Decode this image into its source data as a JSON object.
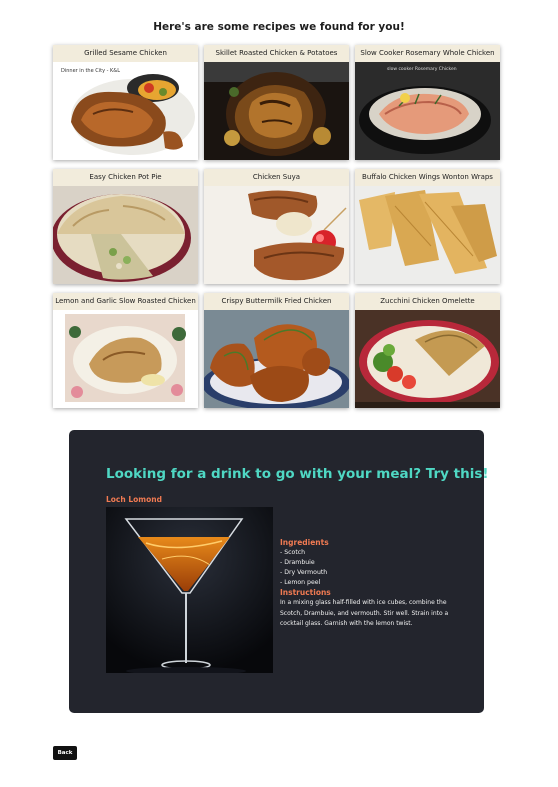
{
  "page": {
    "heading": "Here's are some recipes we found for you!"
  },
  "recipes": [
    {
      "title": "Grilled Sesame Chicken",
      "image": "grilled-chicken-plate-image"
    },
    {
      "title": "Skillet Roasted Chicken & Potatoes",
      "image": "roasted-whole-chicken-image"
    },
    {
      "title": "Slow Cooker Rosemary Whole Chicken",
      "image": "slow-cooker-chicken-image"
    },
    {
      "title": "Easy Chicken Pot Pie",
      "image": "pot-pie-image"
    },
    {
      "title": "Chicken Suya",
      "image": "chicken-suya-image"
    },
    {
      "title": "Buffalo Chicken Wings Wonton Wraps",
      "image": "wonton-wraps-image"
    },
    {
      "title": "Lemon and Garlic Slow Roasted Chicken",
      "image": "lemon-garlic-chicken-image"
    },
    {
      "title": "Crispy Buttermilk Fried Chicken",
      "image": "fried-chicken-image"
    },
    {
      "title": "Zucchini Chicken Omelette",
      "image": "omelette-image"
    }
  ],
  "recipe_image_text": {
    "grilled": "Dinner in the City - K&L",
    "slow_cooker": "slow cooker Rosemary Chicken"
  },
  "drink": {
    "heading": "Looking for a drink to go with your meal? Try this!",
    "name": "Loch Lomond",
    "ingredients_label": "Ingredients",
    "ingredients": [
      "- Scotch",
      "- Drambuie",
      "- Dry Vermouth",
      "- Lemon peel"
    ],
    "instructions_label": "Instructions",
    "instructions": "In a mixing glass half-filled with ice cubes, combine the Scotch, Drambuie, and vermouth. Stir well. Strain into a cocktail glass. Garnish with the lemon twist.",
    "image": "martini-glass-image"
  },
  "back_button": {
    "label": "Back"
  },
  "colors": {
    "panel_bg": "#23252d",
    "heading_teal": "#4fd8c4",
    "accent_orange": "#f07a52",
    "title_bar": "#f2ecdc"
  }
}
